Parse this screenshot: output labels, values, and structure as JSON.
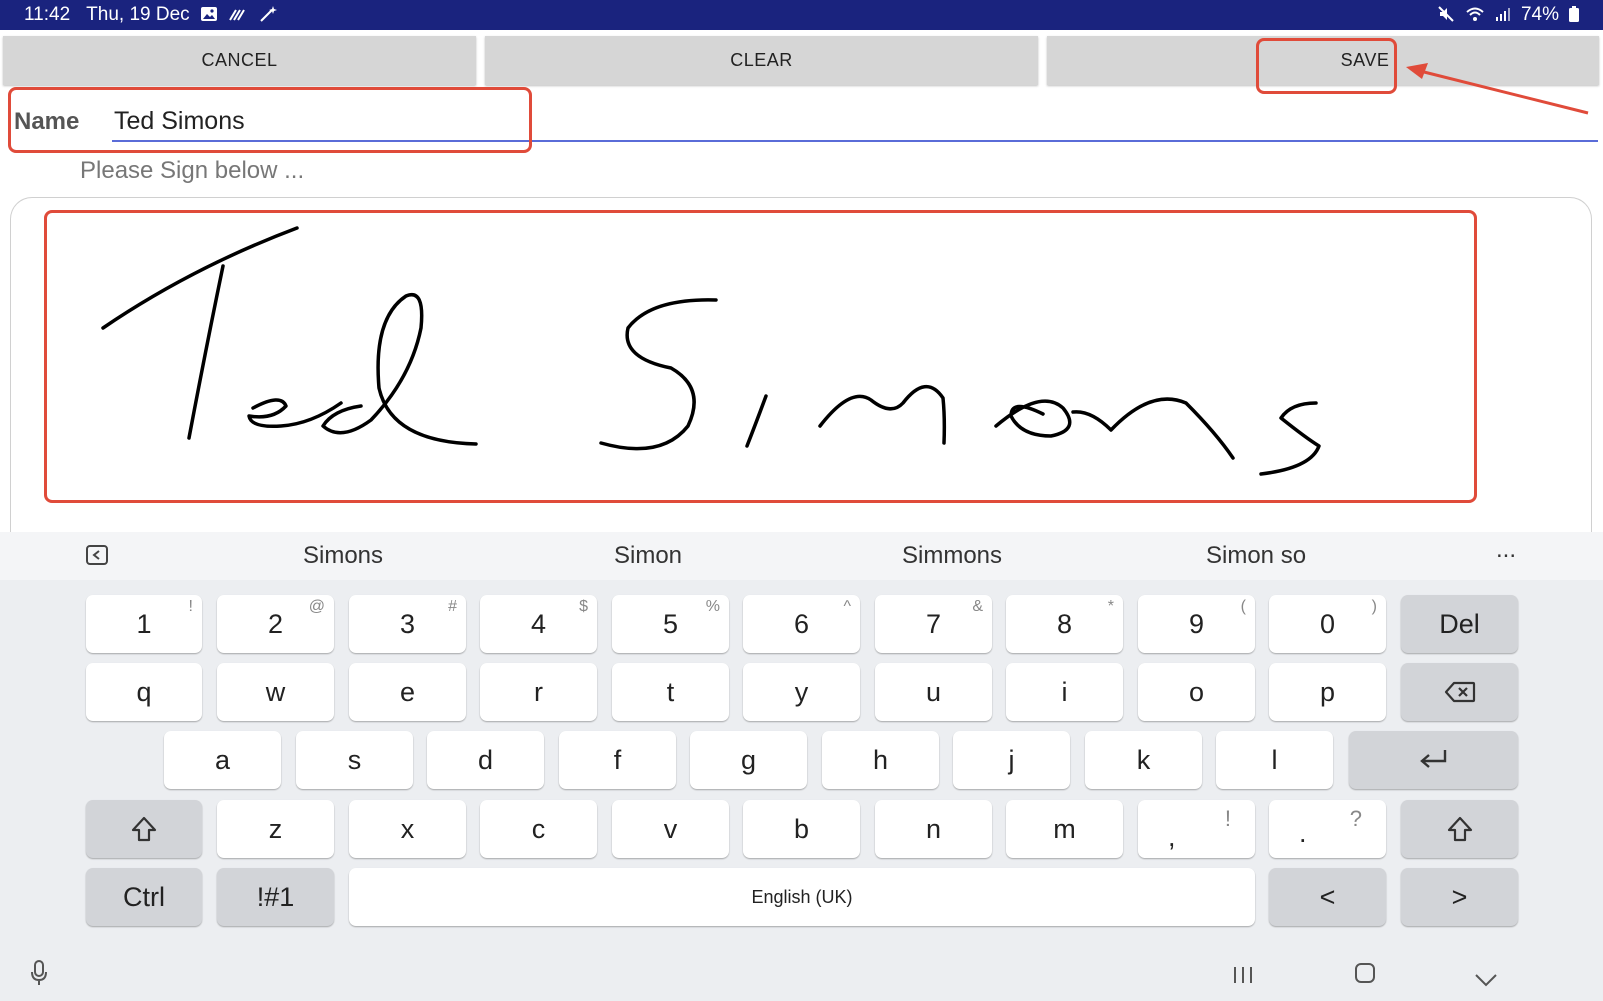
{
  "status_bar": {
    "time": "11:42",
    "date": "Thu, 19 Dec",
    "battery": "74%",
    "icons_left": [
      "gallery-icon",
      "signal-wave-icon",
      "magic-wand-icon"
    ],
    "icons_right": [
      "mute-icon",
      "wifi-icon",
      "cell-signal-icon",
      "battery-icon"
    ]
  },
  "toolbar": {
    "cancel_label": "CANCEL",
    "clear_label": "CLEAR",
    "save_label": "SAVE",
    "button_bg": "#d6d6d6"
  },
  "form": {
    "name_label": "Name",
    "name_value": "Ted Simons",
    "hint": "Please Sign below ..."
  },
  "signature": {
    "stroke_color": "#000000",
    "signed_text": "Ted Simons"
  },
  "annotation": {
    "color": "#e04b3a"
  },
  "keyboard": {
    "suggestions": [
      "Simons",
      "Simon",
      "Simmons",
      "Simon so"
    ],
    "more_label": "...",
    "number_row": [
      {
        "main": "1",
        "alt": "!"
      },
      {
        "main": "2",
        "alt": "@"
      },
      {
        "main": "3",
        "alt": "#"
      },
      {
        "main": "4",
        "alt": "$"
      },
      {
        "main": "5",
        "alt": "%"
      },
      {
        "main": "6",
        "alt": "^"
      },
      {
        "main": "7",
        "alt": "&"
      },
      {
        "main": "8",
        "alt": "*"
      },
      {
        "main": "9",
        "alt": "("
      },
      {
        "main": "0",
        "alt": ")"
      }
    ],
    "row_q": [
      "q",
      "w",
      "e",
      "r",
      "t",
      "y",
      "u",
      "i",
      "o",
      "p"
    ],
    "row_a": [
      "a",
      "s",
      "d",
      "f",
      "g",
      "h",
      "j",
      "k",
      "l"
    ],
    "row_z": [
      "z",
      "x",
      "c",
      "v",
      "b",
      "n",
      "m"
    ],
    "comma_key": {
      "main": ",",
      "alt": "!"
    },
    "period_key": {
      "main": ".",
      "alt": "?"
    },
    "del_label": "Del",
    "ctrl_label": "Ctrl",
    "symbols_label": "!#1",
    "space_label": "English (UK)",
    "left_arrow": "<",
    "right_arrow": ">"
  }
}
